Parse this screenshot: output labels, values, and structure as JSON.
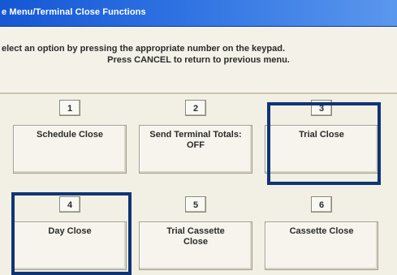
{
  "window": {
    "title": "e Menu/Terminal Close Functions"
  },
  "instructions": {
    "line1": "elect an option by pressing the appropriate number on the keypad.",
    "line2": "Press CANCEL to return to previous menu."
  },
  "options": [
    {
      "number": "1",
      "label": "Schedule Close",
      "highlighted": false
    },
    {
      "number": "2",
      "label": "Send Terminal Totals: OFF",
      "highlighted": false
    },
    {
      "number": "3",
      "label": "Trial Close",
      "highlighted": true
    },
    {
      "number": "4",
      "label": "Day Close",
      "highlighted": true
    },
    {
      "number": "5",
      "label": "Trial Cassette Close",
      "highlighted": false
    },
    {
      "number": "6",
      "label": "Cassette Close",
      "highlighted": false
    }
  ],
  "colors": {
    "titlebar": "#2e72e2",
    "highlight_border": "#0f3575",
    "panel_background": "#f2efe4"
  }
}
